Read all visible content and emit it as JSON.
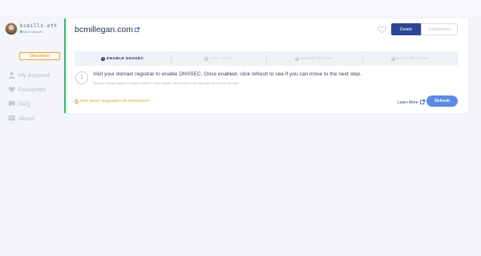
{
  "account": {
    "name": "bcmills.eth",
    "network": "Main Network",
    "disconnect_label": "Disconnect"
  },
  "nav": {
    "items": [
      {
        "label": "My Account",
        "icon": "user-icon"
      },
      {
        "label": "Favourites",
        "icon": "heart-icon"
      },
      {
        "label": "FAQ",
        "icon": "chat-icon"
      },
      {
        "label": "About",
        "icon": "info-icon"
      }
    ]
  },
  "domain": {
    "title": "bcmillegan.com",
    "tabs": [
      {
        "label": "Details",
        "active": true
      },
      {
        "label": "Subdomains",
        "active": false
      }
    ]
  },
  "steps": [
    {
      "num": "1",
      "label": "ENABLE DNSSEC",
      "active": true
    },
    {
      "num": "2",
      "label": "ADD TEXT",
      "active": false
    },
    {
      "num": "3",
      "label": "SUBMIT PROOF",
      "active": false
    },
    {
      "num": "4",
      "label": "MANAGE NAME",
      "active": false
    }
  ],
  "step_detail": {
    "number": "1",
    "instruction": "Visit your domain registrar to enable DNSSEC. Once enabled, click refresh to see if you can move to the next step.",
    "subtext": "Visit your domain registrar to enable DNSSEC. Once enabled, click refresh to see if you can move to the next step."
  },
  "status": {
    "message": "DNS server responded with NXDOMAIN",
    "learn_more": "Learn More",
    "refresh_label": "Refresh"
  },
  "colors": {
    "accent": "#2b4594",
    "refresh": "#5a8be3",
    "success": "#2fbf71",
    "warning": "#e0952a"
  }
}
